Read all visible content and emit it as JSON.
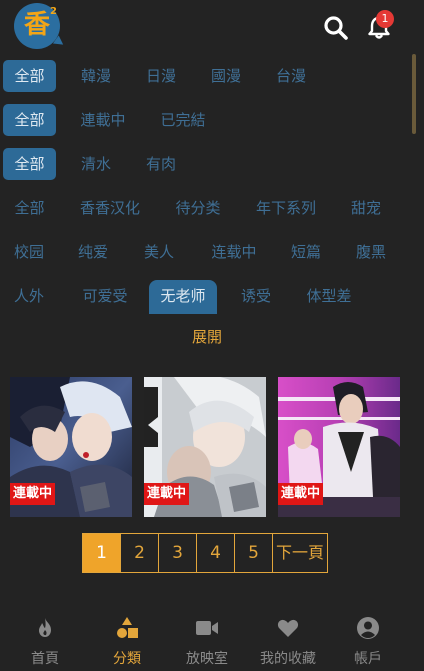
{
  "header": {
    "logo_text": "香",
    "logo_sup": "2",
    "notification_count": "1"
  },
  "filters": {
    "region": [
      "全部",
      "韓漫",
      "日漫",
      "國漫",
      "台漫"
    ],
    "status": [
      "全部",
      "連載中",
      "已完結"
    ],
    "rating": [
      "全部",
      "清水",
      "有肉"
    ],
    "tags_row1": [
      "全部",
      "香香汉化",
      "待分类",
      "年下系列",
      "甜宠"
    ],
    "tags_row2": [
      "校园",
      "纯爱",
      "美人",
      "连载中",
      "短篇",
      "腹黑"
    ],
    "tags_row3": [
      "人外",
      "可爱受",
      "无老师",
      "诱受",
      "体型差"
    ]
  },
  "expand_label": "展開",
  "comics": [
    {
      "badge": "連載中"
    },
    {
      "badge": "連載中"
    },
    {
      "badge": "連載中"
    }
  ],
  "pagination": {
    "pages": [
      "1",
      "2",
      "3",
      "4",
      "5"
    ],
    "current": "1",
    "next_label": "下一頁"
  },
  "tabbar": [
    {
      "label": "首頁"
    },
    {
      "label": "分類"
    },
    {
      "label": "放映室"
    },
    {
      "label": "我的收藏"
    },
    {
      "label": "帳戶"
    }
  ],
  "colors": {
    "background": "#232323",
    "accent": "#e3a63b",
    "chip_active": "#2d6a97",
    "chip_text": "#3f6f95",
    "badge_red": "#e01616"
  }
}
